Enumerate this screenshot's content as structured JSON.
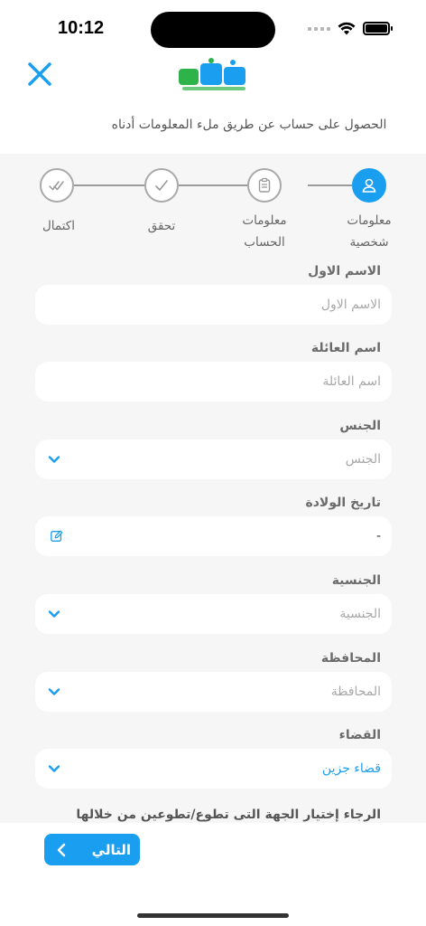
{
  "status_bar": {
    "time": "10:12"
  },
  "header": {
    "subtitle": "الحصول على حساب عن طريق ملء المعلومات أدناه"
  },
  "colors": {
    "accent": "#1a9ff0",
    "background": "#f6f6f6",
    "field": "#ffffff"
  },
  "stepper": {
    "steps": [
      {
        "label_line1": "معلومات",
        "label_line2": "شخصية",
        "icon": "user-icon",
        "active": true
      },
      {
        "label_line1": "معلومات",
        "label_line2": "الحساب",
        "icon": "clipboard-icon",
        "active": false
      },
      {
        "label_line1": "تحقق",
        "label_line2": "",
        "icon": "check-icon",
        "active": false
      },
      {
        "label_line1": "اكتمال",
        "label_line2": "",
        "icon": "double-check-icon",
        "active": false
      }
    ]
  },
  "form": {
    "first_name": {
      "label": "الاسم الاول",
      "placeholder": "الاسم الاول"
    },
    "family_name": {
      "label": "اسم العائلة",
      "placeholder": "اسم العائلة"
    },
    "gender": {
      "label": "الجنس",
      "placeholder": "الجنس"
    },
    "birth_date": {
      "label": "تاريخ الولادة",
      "value": "-"
    },
    "nationality": {
      "label": "الجنسية",
      "placeholder": "الجنسية"
    },
    "governorate": {
      "label": "المحافظة",
      "placeholder": "المحافظة"
    },
    "district": {
      "label": "القضاء",
      "value": "قضاء جزين"
    },
    "org_prompt": "الرجاء إختيار الجهة التى تطوع/تطوعين من خلالها"
  },
  "footer": {
    "next_label": "التالي"
  }
}
